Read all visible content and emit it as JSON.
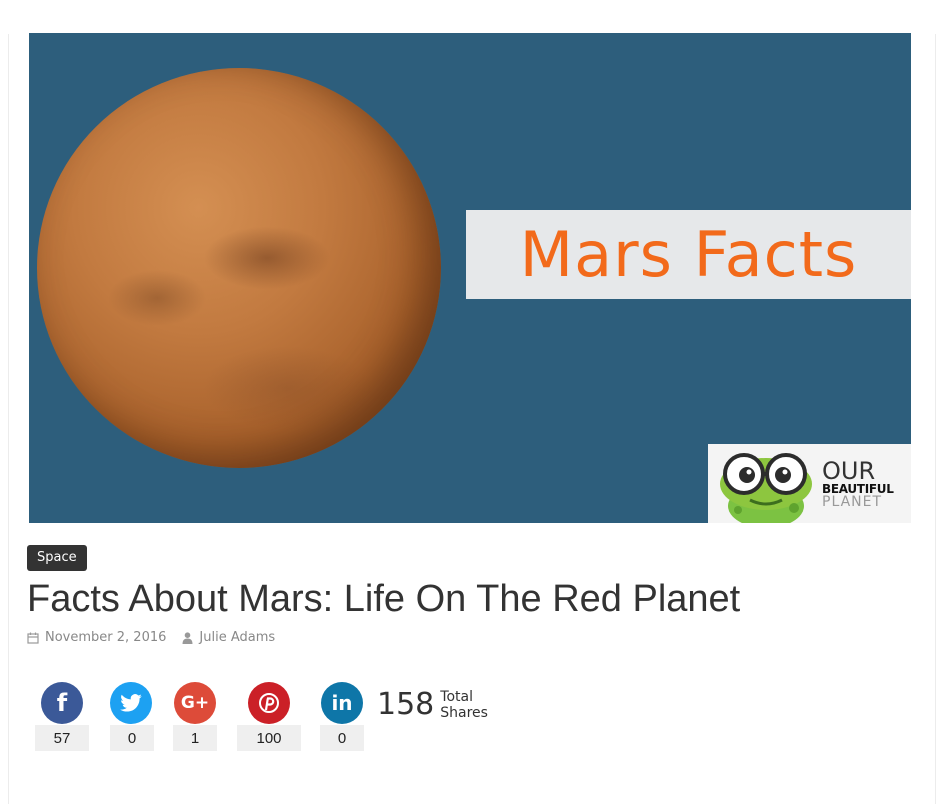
{
  "hero": {
    "banner_text": "Mars Facts",
    "logo": {
      "line1": "OUR",
      "line2": "BEAUTIFUL",
      "line3": "PLANET"
    }
  },
  "post": {
    "category": "Space",
    "title": "Facts About Mars: Life On The Red Planet",
    "date": "November 2, 2016",
    "author": "Julie Adams"
  },
  "social": {
    "buttons": [
      {
        "network": "facebook",
        "icon": "facebook-icon",
        "glyph": "f",
        "color": "#3b5998",
        "count": "57"
      },
      {
        "network": "twitter",
        "icon": "twitter-icon",
        "glyph": "",
        "color": "#1da1f2",
        "count": "0"
      },
      {
        "network": "google-plus",
        "icon": "google-plus-icon",
        "glyph": "G+",
        "color": "#dd4b39",
        "count": "1"
      },
      {
        "network": "pinterest",
        "icon": "pinterest-icon",
        "glyph": "P",
        "color": "#cb2027",
        "count": "100"
      },
      {
        "network": "linkedin",
        "icon": "linkedin-icon",
        "glyph": "in",
        "color": "#0e76a8",
        "count": "0"
      }
    ],
    "total": "158",
    "total_label_1": "Total",
    "total_label_2": "Shares"
  }
}
